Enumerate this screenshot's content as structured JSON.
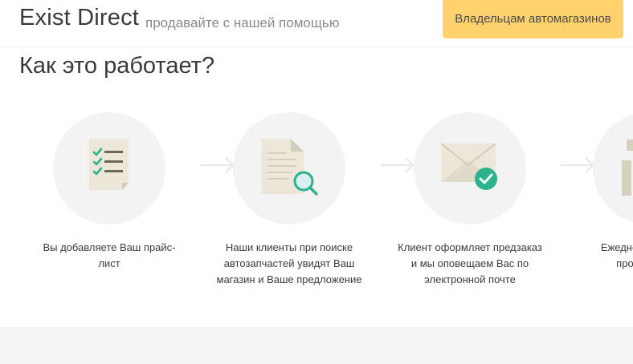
{
  "header": {
    "brand": "Exist Direct",
    "tagline": "продавайте с нашей помощью",
    "owners_button": "Владельцам автомагазинов"
  },
  "section": {
    "title": "Как это работает?"
  },
  "steps": [
    {
      "text": "Вы добавляете Ваш прайс-лист",
      "icon": "checklist-document-icon"
    },
    {
      "text": "Наши клиенты при поиске автозапчастей увидят Ваш магазин и Ваше предложение",
      "icon": "document-search-icon"
    },
    {
      "text": "Клиент оформляет предзаказ и мы оповещаем Вас по электронной почте",
      "icon": "envelope-check-icon"
    },
    {
      "text": "Ежедне... отправл... просмотрах...",
      "icon": "chart-icon"
    }
  ],
  "colors": {
    "accent_yellow": "#ffd26e",
    "check_green": "#2cb28d",
    "paper": "#ece7d8",
    "circle_bg": "#f3f3f3"
  }
}
